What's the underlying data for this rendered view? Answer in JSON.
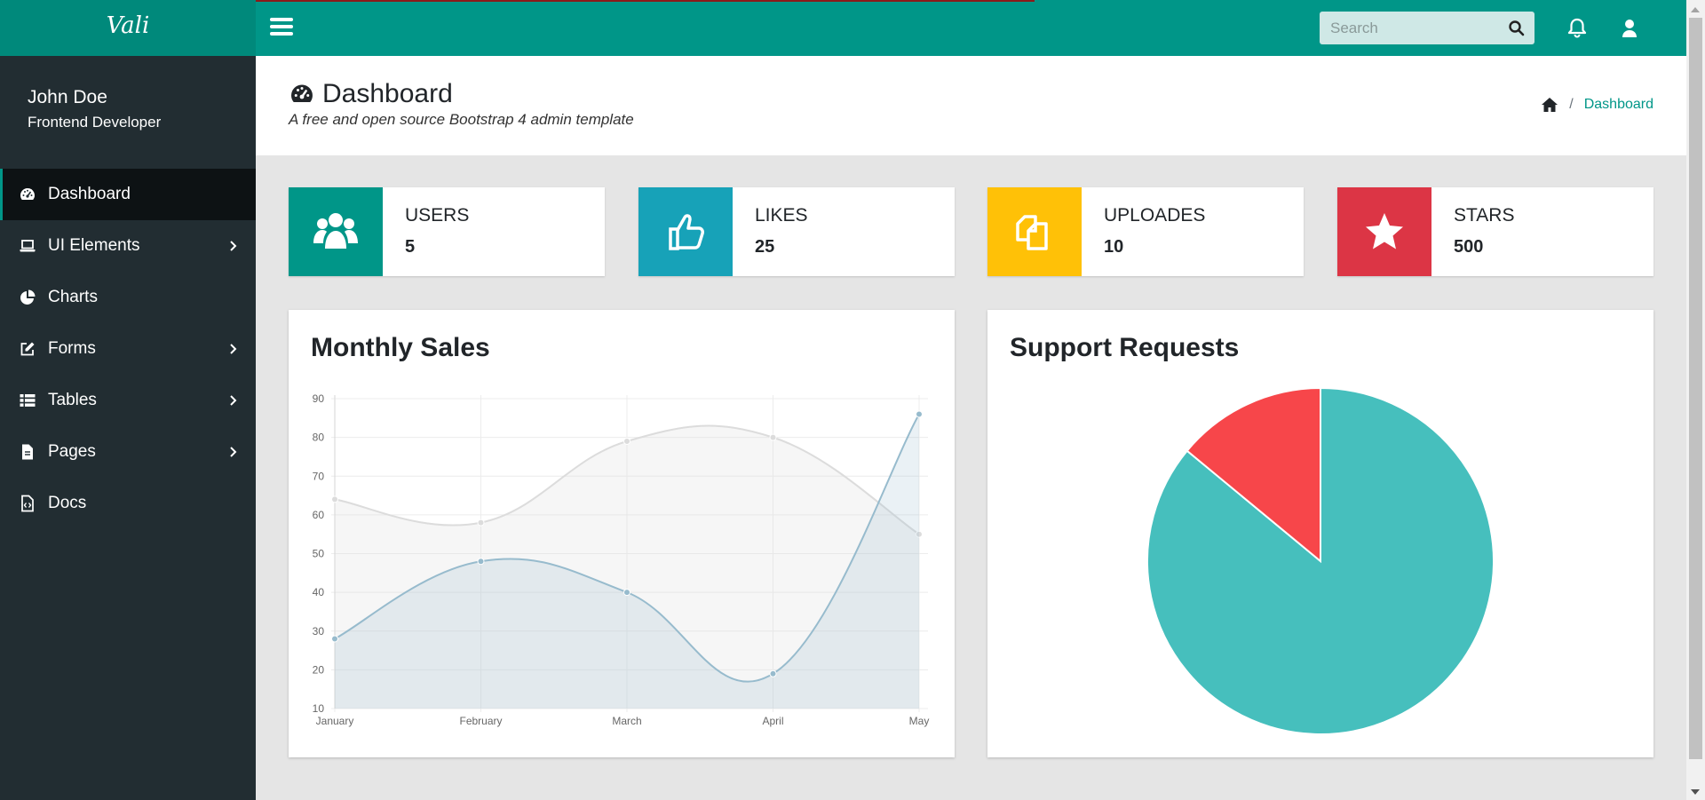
{
  "app": {
    "brand": "Vali"
  },
  "header": {
    "search_placeholder": "Search",
    "icons": [
      "menu-icon",
      "search-icon",
      "bell-icon",
      "user-icon"
    ]
  },
  "sidebar": {
    "user": {
      "name": "John Doe",
      "role": "Frontend Developer"
    },
    "items": [
      {
        "label": "Dashboard",
        "icon": "dashboard-icon",
        "active": true,
        "has_submenu": false
      },
      {
        "label": "UI Elements",
        "icon": "laptop-icon",
        "active": false,
        "has_submenu": true
      },
      {
        "label": "Charts",
        "icon": "pie-chart-icon",
        "active": false,
        "has_submenu": false
      },
      {
        "label": "Forms",
        "icon": "edit-icon",
        "active": false,
        "has_submenu": true
      },
      {
        "label": "Tables",
        "icon": "table-icon",
        "active": false,
        "has_submenu": true
      },
      {
        "label": "Pages",
        "icon": "file-icon",
        "active": false,
        "has_submenu": true
      },
      {
        "label": "Docs",
        "icon": "file-code-icon",
        "active": false,
        "has_submenu": false
      }
    ]
  },
  "page": {
    "title": "Dashboard",
    "subtitle": "A free and open source Bootstrap 4 admin template",
    "breadcrumb": {
      "home_icon": "home-icon",
      "separator": "/",
      "current": "Dashboard"
    }
  },
  "widgets": [
    {
      "label": "USERS",
      "value": "5",
      "icon": "users-icon",
      "color": "#009688"
    },
    {
      "label": "LIKES",
      "value": "25",
      "icon": "thumbs-up-icon",
      "color": "#17a2b8"
    },
    {
      "label": "UPLOADES",
      "value": "10",
      "icon": "files-icon",
      "color": "#ffc107"
    },
    {
      "label": "STARS",
      "value": "500",
      "icon": "star-icon",
      "color": "#dc3545"
    }
  ],
  "tiles": {
    "monthly_sales_title": "Monthly Sales",
    "support_requests_title": "Support Requests"
  },
  "chart_data": [
    {
      "type": "line",
      "title": "Monthly Sales",
      "x": [
        "January",
        "February",
        "March",
        "April",
        "May"
      ],
      "ylim": [
        10,
        90
      ],
      "yticks": [
        10,
        20,
        30,
        40,
        50,
        60,
        70,
        80,
        90
      ],
      "grid": true,
      "area_fill": true,
      "series": [
        {
          "values": [
            64,
            58,
            79,
            80,
            55
          ],
          "color": "#dcdcdc"
        },
        {
          "values": [
            28,
            48,
            40,
            19,
            86
          ],
          "color": "#97bbcd"
        }
      ]
    },
    {
      "type": "pie",
      "title": "Support Requests",
      "slices": [
        {
          "value": 86,
          "color": "#46bfbd"
        },
        {
          "value": 14,
          "color": "#f7464a"
        }
      ]
    }
  ],
  "colors": {
    "primary": "#009688",
    "sidebar": "#222d32",
    "body": "#e5e5e5"
  }
}
